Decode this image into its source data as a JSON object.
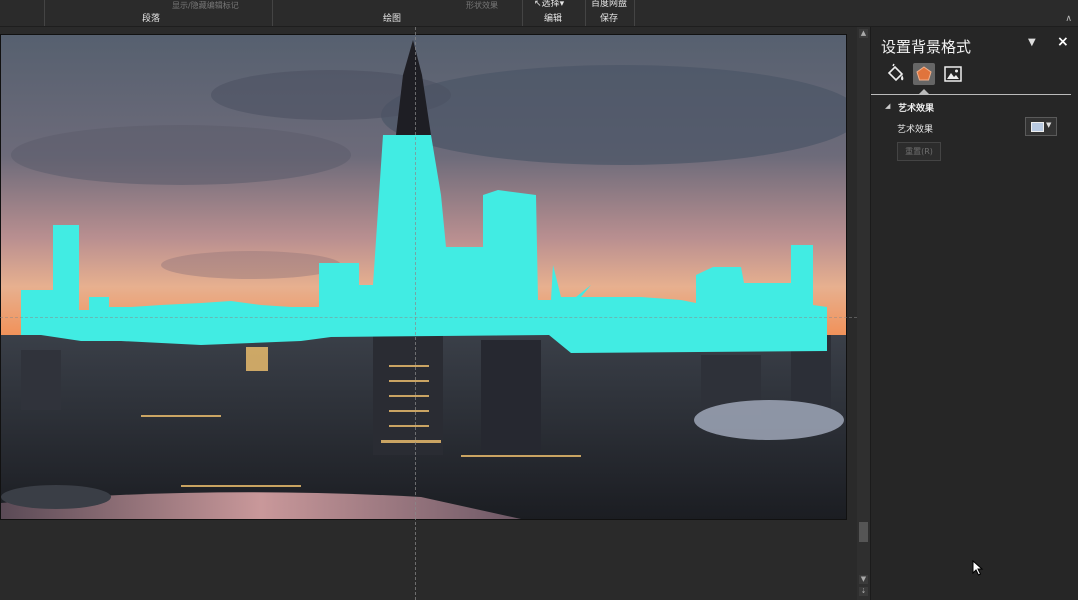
{
  "ribbon": {
    "faint_items": [
      "显示/隐藏编辑标记",
      "形状效果"
    ],
    "groups": [
      {
        "label": "段落"
      },
      {
        "label": "绘图"
      },
      {
        "label": "编辑"
      },
      {
        "label": "保存"
      }
    ],
    "select_label": "选择",
    "save_baidu_label": "百度网盘"
  },
  "slide": {
    "sky_colors": [
      "#56606f",
      "#8b7c85",
      "#e7b08f",
      "#f1925a"
    ],
    "city_colors": [
      "#24272d",
      "#3a3f48"
    ],
    "silhouette_color": "#41ece3"
  },
  "panel": {
    "title": "设置背景格式",
    "menu_icon": "chevron-down-icon",
    "close_label": "×",
    "tabs": [
      {
        "name": "fill-tab",
        "icon": "paint-bucket-icon"
      },
      {
        "name": "effects-tab",
        "icon": "pentagon-icon",
        "selected": true
      },
      {
        "name": "picture-tab",
        "icon": "picture-icon"
      }
    ],
    "section_title": "艺术效果",
    "art_effect_label": "艺术效果",
    "reset_label": "重置(R)"
  }
}
